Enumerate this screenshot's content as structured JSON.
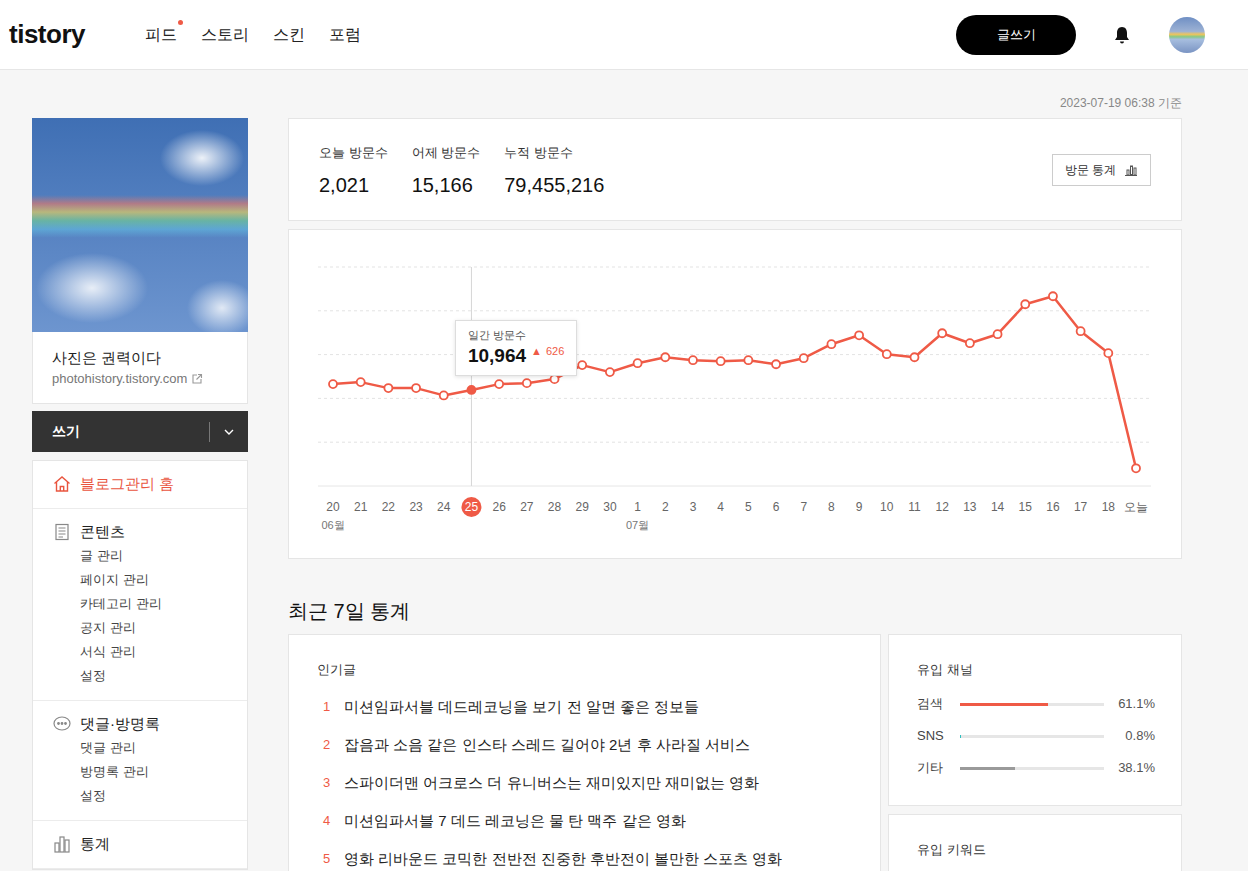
{
  "header": {
    "logo": "tistory",
    "nav": [
      {
        "label": "피드",
        "badge": true
      },
      {
        "label": "스토리",
        "badge": false
      },
      {
        "label": "스킨",
        "badge": false
      },
      {
        "label": "포럼",
        "badge": false
      }
    ],
    "write_button": "글쓰기"
  },
  "timestamp": "2023-07-19 06:38 기준",
  "blog": {
    "title": "사진은 권력이다",
    "url": "photohistory.tistory.com"
  },
  "write_menu": {
    "label": "쓰기"
  },
  "sidebar": {
    "sections": [
      {
        "title": "블로그관리 홈",
        "selected": true,
        "items": []
      },
      {
        "title": "콘텐츠",
        "selected": false,
        "items": [
          "글 관리",
          "페이지 관리",
          "카테고리 관리",
          "공지 관리",
          "서식 관리",
          "설정"
        ]
      },
      {
        "title": "댓글·방명록",
        "selected": false,
        "items": [
          "댓글 관리",
          "방명록 관리",
          "설정"
        ]
      },
      {
        "title": "통계",
        "selected": false,
        "items": []
      }
    ]
  },
  "stats": {
    "items": [
      {
        "label": "오늘 방문수",
        "value": "2,021"
      },
      {
        "label": "어제 방문수",
        "value": "15,166"
      },
      {
        "label": "누적 방문수",
        "value": "79,455,216"
      }
    ],
    "button": "방문 통계"
  },
  "chart": {
    "series": [
      {
        "name": "일간 방문수",
        "values": [
          11630,
          11860,
          11180,
          11180,
          10338,
          10964,
          11630,
          11740,
          12200,
          13800,
          13000,
          14020,
          14700,
          14360,
          14250,
          14360,
          13900,
          14590,
          16190,
          17200,
          15050,
          14700,
          17440,
          16300,
          17330,
          20750,
          21660,
          17670,
          15166,
          2021
        ]
      }
    ],
    "x_labels": [
      {
        "label": "20",
        "selected": false
      },
      {
        "label": "21",
        "selected": false
      },
      {
        "label": "22",
        "selected": false
      },
      {
        "label": "23",
        "selected": false
      },
      {
        "label": "24",
        "selected": false
      },
      {
        "label": "25",
        "selected": true
      },
      {
        "label": "26",
        "selected": false
      },
      {
        "label": "27",
        "selected": false
      },
      {
        "label": "28",
        "selected": false
      },
      {
        "label": "29",
        "selected": false
      },
      {
        "label": "30",
        "selected": false
      },
      {
        "label": "1",
        "selected": false
      },
      {
        "label": "2",
        "selected": false
      },
      {
        "label": "3",
        "selected": false
      },
      {
        "label": "4",
        "selected": false
      },
      {
        "label": "5",
        "selected": false
      },
      {
        "label": "6",
        "selected": false
      },
      {
        "label": "7",
        "selected": false
      },
      {
        "label": "8",
        "selected": false
      },
      {
        "label": "9",
        "selected": false
      },
      {
        "label": "10",
        "selected": false
      },
      {
        "label": "11",
        "selected": false
      },
      {
        "label": "12",
        "selected": false
      },
      {
        "label": "13",
        "selected": false
      },
      {
        "label": "14",
        "selected": false
      },
      {
        "label": "15",
        "selected": false
      },
      {
        "label": "16",
        "selected": false
      },
      {
        "label": "17",
        "selected": false
      },
      {
        "label": "18",
        "selected": false
      },
      {
        "label": "오늘",
        "selected": false
      }
    ],
    "months": [
      {
        "label": "06월",
        "first_day": "20"
      },
      {
        "label": "07월",
        "first_day": "1"
      }
    ],
    "tooltip": {
      "title": "일간 방문수",
      "value": "10,964",
      "delta_icon": "▲",
      "delta": "626"
    }
  },
  "recent": {
    "title": "최근 7일 통계",
    "popular": {
      "title": "인기글",
      "posts": [
        {
          "rank": "1",
          "title": "미션임파서블 데드레코닝을 보기 전 알면 좋은 정보들"
        },
        {
          "rank": "2",
          "title": "잡음과 소음 같은 인스타 스레드 길어야 2년 후 사라질 서비스"
        },
        {
          "rank": "3",
          "title": "스파이더맨 어크로스 더 유니버스는 재미있지만 재미없는 영화"
        },
        {
          "rank": "4",
          "title": "미션임파서블 7 데드 레코닝은 물 탄 맥주 같은 영화"
        },
        {
          "rank": "5",
          "title": "영화 리바운드 코믹한 전반전 진중한 후반전이 볼만한 스포츠 영화"
        }
      ]
    },
    "channels": {
      "title": "유입 채널",
      "items": [
        {
          "label": "검색",
          "level": 0.611,
          "reading": "61.1%",
          "color": "#ef5a46"
        },
        {
          "label": "SNS",
          "level": 0.008,
          "reading": "0.8%",
          "color": "#2bbfbf"
        },
        {
          "label": "기타",
          "level": 0.381,
          "reading": "38.1%",
          "color": "#9a9a9a"
        }
      ]
    },
    "keywords": {
      "title": "유입 키워드"
    }
  }
}
